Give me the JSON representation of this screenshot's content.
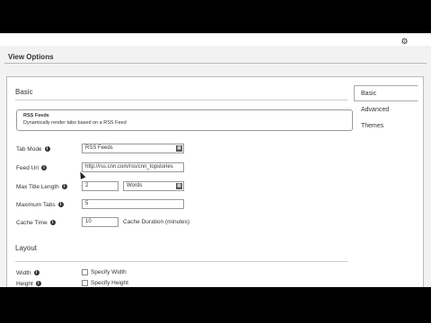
{
  "header": {
    "gear_icon": "gear-icon"
  },
  "page": {
    "title": "View Options"
  },
  "tabs": [
    {
      "label": "Basic",
      "active": true
    },
    {
      "label": "Advanced",
      "active": false
    },
    {
      "label": "Themes",
      "active": false
    }
  ],
  "basic": {
    "section_title": "Basic",
    "info": {
      "heading": "RSS Feeds",
      "description": "Dynamically render tabs based on a RSS Feed"
    },
    "tab_mode": {
      "label": "Tab Mode",
      "value": "RSS Feeds"
    },
    "feed_url": {
      "label": "Feed Url",
      "value": "http://rss.cnn.com/rss/cnn_topstories"
    },
    "max_title_length": {
      "label": "Max Title Length",
      "value": "2",
      "unit": "Words"
    },
    "maximum_tabs": {
      "label": "Maximum Tabs",
      "value": "5"
    },
    "cache_time": {
      "label": "Cache Time",
      "value": "10",
      "suffix": "Cache Duration (minutes)"
    }
  },
  "layout": {
    "section_title": "Layout",
    "width": {
      "label": "Width",
      "checkbox_label": "Specify Width"
    },
    "height": {
      "label": "Height",
      "checkbox_label": "Specify Height"
    }
  }
}
